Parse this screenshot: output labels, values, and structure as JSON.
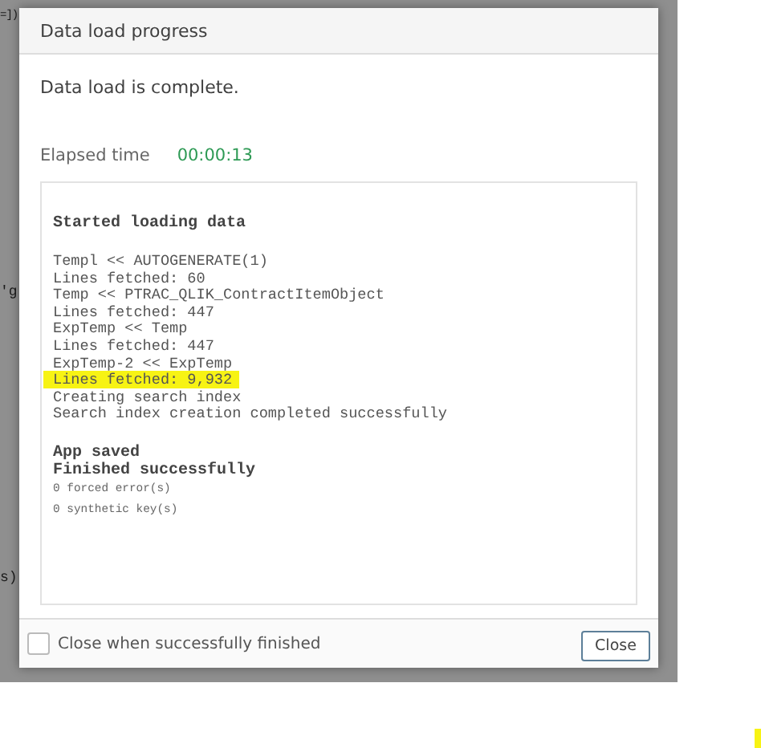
{
  "background_code": [
    {
      "text": "=])"
    },
    {
      "text": "'g"
    },
    {
      "text": "s)"
    }
  ],
  "dialog": {
    "title": "Data load progress",
    "message": "Data load is complete.",
    "elapsed_label": "Elapsed time",
    "elapsed_value": "00:00:13",
    "log": [
      {
        "kind": "heading",
        "text": "Started loading data",
        "highlighted": false
      },
      {
        "kind": "gap"
      },
      {
        "kind": "line",
        "text": "Templ << AUTOGENERATE(1)",
        "highlighted": false
      },
      {
        "kind": "line",
        "text": "Lines fetched: 60",
        "highlighted": false
      },
      {
        "kind": "line",
        "text": "Temp << PTRAC_QLIK_ContractItemObject",
        "highlighted": false
      },
      {
        "kind": "line",
        "text": "Lines fetched: 447",
        "highlighted": false
      },
      {
        "kind": "line",
        "text": "ExpTemp << Temp",
        "highlighted": false
      },
      {
        "kind": "line",
        "text": "Lines fetched: 447",
        "highlighted": false
      },
      {
        "kind": "line",
        "text": "ExpTemp-2 << ExpTemp",
        "highlighted": false
      },
      {
        "kind": "line",
        "text": "Lines fetched: 9,932",
        "highlighted": true
      },
      {
        "kind": "line",
        "text": "Creating search index",
        "highlighted": false
      },
      {
        "kind": "line",
        "text": "Search index creation completed successfully",
        "highlighted": false
      },
      {
        "kind": "gap"
      },
      {
        "kind": "heading",
        "text": "App saved",
        "highlighted": false
      },
      {
        "kind": "heading",
        "text": "Finished successfully",
        "highlighted": false
      },
      {
        "kind": "small",
        "text": "0 forced error(s)",
        "highlighted": false
      },
      {
        "kind": "small",
        "text": "0 synthetic key(s)",
        "highlighted": false
      }
    ],
    "close_when_finished": {
      "label": "Close when successfully finished",
      "checked": false
    },
    "buttons": [
      {
        "label": "Close"
      }
    ]
  }
}
